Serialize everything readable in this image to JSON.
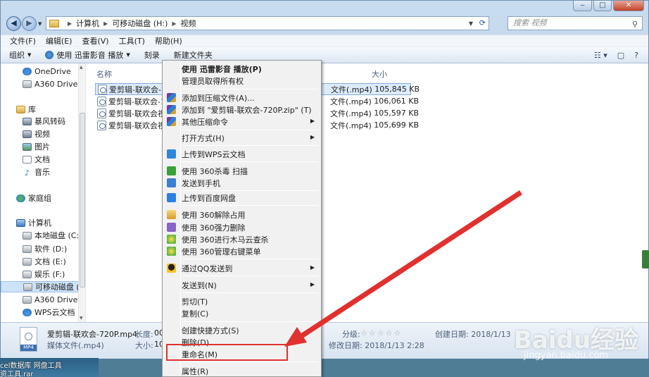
{
  "window": {
    "min": "‒",
    "max": "□",
    "close": "✕"
  },
  "address": {
    "crumbs": [
      "计算机",
      "可移动磁盘 (H:)",
      "视频"
    ],
    "search_placeholder": "搜索 视频"
  },
  "menubar": [
    "文件(F)",
    "编辑(E)",
    "查看(V)",
    "工具(T)",
    "帮助(H)"
  ],
  "cmdbar": {
    "organize": "组织",
    "play": "使用 迅雷影音 播放",
    "burn": "刻录",
    "new_folder": "新建文件夹"
  },
  "nav": {
    "items": [
      {
        "label": "OneDrive",
        "icon": "cloud"
      },
      {
        "label": "A360 Drive",
        "icon": "drive"
      },
      {
        "label": "库",
        "icon": "lib"
      },
      {
        "label": "暴风转码",
        "icon": "vid"
      },
      {
        "label": "视频",
        "icon": "vid"
      },
      {
        "label": "图片",
        "icon": "pic"
      },
      {
        "label": "文档",
        "icon": "doc"
      },
      {
        "label": "音乐",
        "icon": "music"
      },
      {
        "label": "家庭组",
        "icon": "hg"
      },
      {
        "label": "计算机",
        "icon": "pc"
      },
      {
        "label": "本地磁盘 (C:)",
        "icon": "drive"
      },
      {
        "label": "软件 (D:)",
        "icon": "drive"
      },
      {
        "label": "文档 (E:)",
        "icon": "drive"
      },
      {
        "label": "娱乐 (F:)",
        "icon": "drive"
      },
      {
        "label": "可移动磁盘 (H",
        "icon": "drive"
      },
      {
        "label": "A360 Drive",
        "icon": "drive"
      },
      {
        "label": "WPS云文档",
        "icon": "cloud"
      }
    ]
  },
  "files": {
    "columns": {
      "name": "名称",
      "size": "大小"
    },
    "rows": [
      {
        "name": "爱剪辑-联欢会-720",
        "type": "文件(.mp4)",
        "size": "105,845 KB"
      },
      {
        "name": "爱剪辑-联欢会-108",
        "type": "文件(.mp4)",
        "size": "106,061 KB"
      },
      {
        "name": "爱剪辑-联欢会视频",
        "type": "文件(.mp4)",
        "size": "105,597 KB"
      },
      {
        "name": "爱剪辑-联欢会视频",
        "type": "文件(.mp4)",
        "size": "105,699 KB"
      }
    ]
  },
  "details": {
    "filename": "爱剪辑-联欢会-720P.mp4",
    "filetype": "媒体文件(.mp4)",
    "len_label": "长度:",
    "len_val": "00",
    "size_label": "大小:",
    "size_val": "10",
    "rating_label": "分级:",
    "created": "创建日期: 2018/1/13",
    "modified": "修改日期: 2018/1/13 2:28",
    "thumb_tag": "MP4"
  },
  "context_menu": [
    {
      "label": "使用 迅雷影音 播放(P)",
      "bold": true
    },
    {
      "label": "管理员取得所有权"
    },
    {
      "label": "添加到压缩文件(A)...",
      "icon": "rar"
    },
    {
      "label": "添加到 \"爱剪辑-联欢会-720P.zip\" (T)",
      "icon": "rar"
    },
    {
      "label": "其他压缩命令",
      "icon": "rar",
      "sub": true
    },
    {
      "label": "打开方式(H)",
      "sub": true
    },
    {
      "label": "上传到WPS云文档",
      "icon": "cloud"
    },
    {
      "label": "使用 360杀毒 扫描",
      "icon": "shield"
    },
    {
      "label": "发送到手机",
      "icon": "phone"
    },
    {
      "label": "上传到百度网盘",
      "icon": "baidu"
    },
    {
      "label": "使用 360解除占用",
      "icon": "folder"
    },
    {
      "label": "使用 360强力删除",
      "icon": "purple"
    },
    {
      "label": "使用 360进行木马云查杀",
      "icon": "360"
    },
    {
      "label": "使用 360管理右键菜单",
      "icon": "360"
    },
    {
      "label": "通过QQ发送到",
      "icon": "qq",
      "sub": true
    },
    {
      "label": "发送到(N)",
      "sub": true
    },
    {
      "label": "剪切(T)"
    },
    {
      "label": "复制(C)"
    },
    {
      "label": "创建快捷方式(S)"
    },
    {
      "label": "删除(D)"
    },
    {
      "label": "重命名(M)"
    },
    {
      "label": "属性(R)"
    }
  ],
  "taskbar": {
    "line1": "cel数据库  网盘工具",
    "line2": "资工具.rar"
  },
  "watermark": {
    "logo": "Baidu经验",
    "url": "jingyan.baidu.com"
  },
  "colors": {
    "highlight_box": "#e0312e",
    "arrow": "#e0312e",
    "selection": "#dcebfc"
  }
}
